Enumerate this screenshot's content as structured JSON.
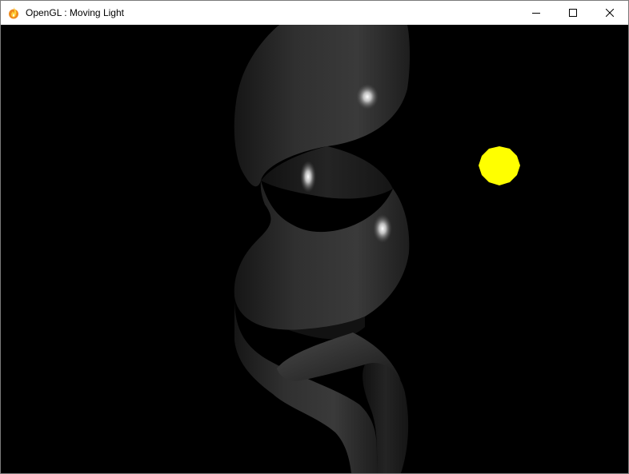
{
  "window": {
    "title": "OpenGL : Moving Light",
    "app_icon": "flame-icon",
    "controls": [
      {
        "name": "minimize",
        "icon": "minimize-icon"
      },
      {
        "name": "maximize",
        "icon": "maximize-icon"
      },
      {
        "name": "close",
        "icon": "close-icon"
      }
    ]
  },
  "scene": {
    "background_color": "#000000",
    "object": "gray-helix-ribbon",
    "light_color": "#ffff00"
  }
}
